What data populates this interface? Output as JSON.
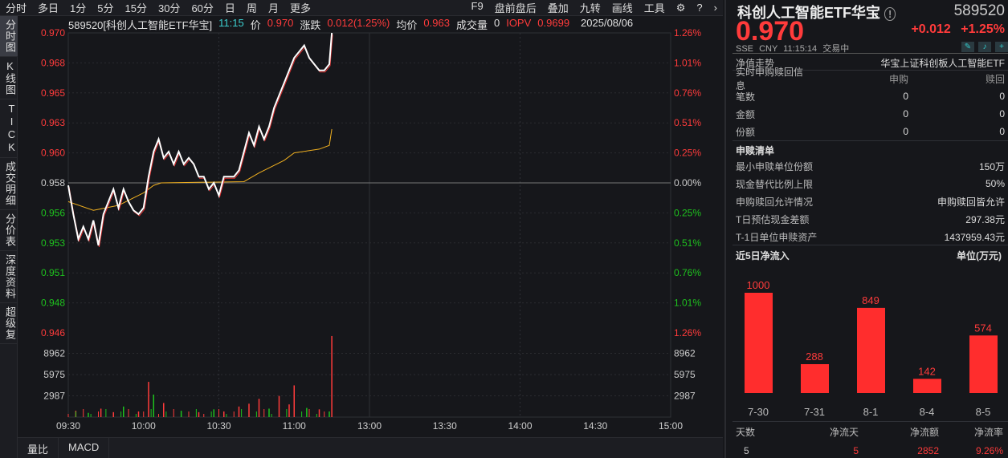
{
  "topbar": {
    "left": [
      "分时",
      "多日",
      "1分",
      "5分",
      "15分",
      "30分",
      "60分",
      "日",
      "周",
      "月",
      "更多"
    ],
    "right": [
      "F9",
      "盘前盘后",
      "叠加",
      "九转",
      "画线",
      "工具"
    ]
  },
  "lefttabs": [
    "分时图",
    "K线图",
    "TICK",
    "成交明细",
    "分价表",
    "深度资料",
    "超级复"
  ],
  "info": {
    "title": "589520[科创人工智能ETF华宝]",
    "time": "11:15",
    "price_label": "价",
    "price": "0.970",
    "change_label": "涨跌",
    "change": "0.012(1.25%)",
    "avg_label": "均价",
    "avg": "0.963",
    "vol_label": "成交量",
    "vol": "0",
    "iopv_label": "IOPV",
    "iopv": "0.9699",
    "date": "2025/08/06"
  },
  "bottomtabs": [
    "量比",
    "MACD"
  ],
  "chart_data": {
    "type": "line",
    "price_ticks": [
      "0.970",
      "0.968",
      "0.965",
      "0.963",
      "0.960",
      "0.958",
      "0.956",
      "0.953",
      "0.951",
      "0.948",
      "0.946"
    ],
    "pct_ticks": [
      "1.26%",
      "1.01%",
      "0.76%",
      "0.51%",
      "0.25%",
      "0.00%",
      "0.25%",
      "0.51%",
      "0.76%",
      "1.01%",
      "1.26%"
    ],
    "vol_ticks": [
      "8962",
      "5975",
      "2987"
    ],
    "time_ticks": [
      "09:30",
      "10:00",
      "10:30",
      "11:00",
      "13:00",
      "13:30",
      "14:00",
      "14:30",
      "15:00"
    ],
    "ylim": [
      0.946,
      0.97
    ],
    "prev_close": 0.958,
    "vol_max": 11949,
    "price": [
      [
        0,
        0.9578
      ],
      [
        2,
        0.9555
      ],
      [
        4,
        0.9535
      ],
      [
        6,
        0.9545
      ],
      [
        8,
        0.9535
      ],
      [
        10,
        0.955
      ],
      [
        12,
        0.953
      ],
      [
        14,
        0.9555
      ],
      [
        16,
        0.9565
      ],
      [
        18,
        0.9575
      ],
      [
        20,
        0.956
      ],
      [
        22,
        0.9575
      ],
      [
        24,
        0.9565
      ],
      [
        26,
        0.9558
      ],
      [
        28,
        0.9555
      ],
      [
        30,
        0.956
      ],
      [
        32,
        0.9585
      ],
      [
        34,
        0.9605
      ],
      [
        36,
        0.9615
      ],
      [
        38,
        0.96
      ],
      [
        40,
        0.9605
      ],
      [
        42,
        0.9595
      ],
      [
        44,
        0.9605
      ],
      [
        46,
        0.9595
      ],
      [
        48,
        0.96
      ],
      [
        50,
        0.9595
      ],
      [
        52,
        0.9585
      ],
      [
        54,
        0.9585
      ],
      [
        56,
        0.9575
      ],
      [
        58,
        0.958
      ],
      [
        60,
        0.957
      ],
      [
        62,
        0.9585
      ],
      [
        64,
        0.9585
      ],
      [
        66,
        0.9585
      ],
      [
        68,
        0.959
      ],
      [
        70,
        0.9605
      ],
      [
        72,
        0.962
      ],
      [
        74,
        0.961
      ],
      [
        76,
        0.9625
      ],
      [
        78,
        0.9615
      ],
      [
        80,
        0.9625
      ],
      [
        82,
        0.964
      ],
      [
        84,
        0.965
      ],
      [
        86,
        0.966
      ],
      [
        88,
        0.967
      ],
      [
        90,
        0.968
      ],
      [
        92,
        0.9685
      ],
      [
        94,
        0.969
      ],
      [
        96,
        0.968
      ],
      [
        98,
        0.9675
      ],
      [
        100,
        0.967
      ],
      [
        102,
        0.967
      ],
      [
        104,
        0.9675
      ],
      [
        105,
        0.97
      ]
    ],
    "avg": [
      [
        0,
        0.9565
      ],
      [
        10,
        0.9558
      ],
      [
        20,
        0.9562
      ],
      [
        30,
        0.9572
      ],
      [
        34,
        0.9578
      ],
      [
        37,
        0.958
      ],
      [
        70,
        0.9581
      ],
      [
        76,
        0.9588
      ],
      [
        86,
        0.9598
      ],
      [
        90,
        0.9604
      ],
      [
        100,
        0.9607
      ],
      [
        104,
        0.961
      ],
      [
        105,
        0.9623
      ]
    ],
    "volume": [
      [
        3,
        900,
        1
      ],
      [
        8,
        600,
        0
      ],
      [
        13,
        1200,
        1
      ],
      [
        18,
        700,
        1
      ],
      [
        22,
        1500,
        0
      ],
      [
        28,
        800,
        1
      ],
      [
        32,
        5000,
        1
      ],
      [
        34,
        3200,
        0
      ],
      [
        38,
        2000,
        1
      ],
      [
        45,
        900,
        0
      ],
      [
        52,
        700,
        1
      ],
      [
        58,
        1100,
        0
      ],
      [
        62,
        800,
        1
      ],
      [
        68,
        1500,
        1
      ],
      [
        72,
        1900,
        1
      ],
      [
        76,
        2600,
        1
      ],
      [
        80,
        1200,
        0
      ],
      [
        84,
        3000,
        1
      ],
      [
        88,
        1800,
        1
      ],
      [
        90,
        4500,
        1
      ],
      [
        95,
        1300,
        0
      ],
      [
        100,
        1100,
        1
      ],
      [
        104,
        800,
        0
      ],
      [
        105,
        11500,
        1
      ]
    ]
  },
  "panel": {
    "name": "科创人工智能ETF华宝",
    "code": "589520",
    "price": "0.970",
    "change": "+0.012",
    "pct": "+1.25%",
    "meta": "SSE  CNY  11:15:14  交易中",
    "nav_label": "净值走势",
    "nav_value": "华宝上证科创板人工智能ETF",
    "rt_label": "实时申购赎回信息",
    "rt_h1": "申购",
    "rt_h2": "赎回",
    "rt_rows": [
      {
        "k": "笔数",
        "a": "0",
        "b": "0"
      },
      {
        "k": "金额",
        "a": "0",
        "b": "0"
      },
      {
        "k": "份额",
        "a": "0",
        "b": "0"
      }
    ],
    "list_label": "申赎清单",
    "list_rows": [
      {
        "k": "最小申赎单位份额",
        "v": "150万"
      },
      {
        "k": "现金替代比例上限",
        "v": "50%"
      },
      {
        "k": "申购赎回允许情况",
        "v": "申购赎回皆允许"
      },
      {
        "k": "T日预估现金差额",
        "v": "297.38元"
      },
      {
        "k": "T-1日单位申赎资产",
        "v": "1437959.43元"
      }
    ],
    "flow_label": "近5日净流入",
    "flow_unit": "单位(万元)",
    "flow": {
      "categories": [
        "7-30",
        "7-31",
        "8-1",
        "8-4",
        "8-5"
      ],
      "values": [
        1000,
        288,
        849,
        142,
        574
      ]
    },
    "summary_h": [
      "天数",
      "净流天",
      "净流额",
      "净流率"
    ],
    "summary_v": [
      "5",
      "5",
      "2852",
      "9.26%"
    ]
  }
}
